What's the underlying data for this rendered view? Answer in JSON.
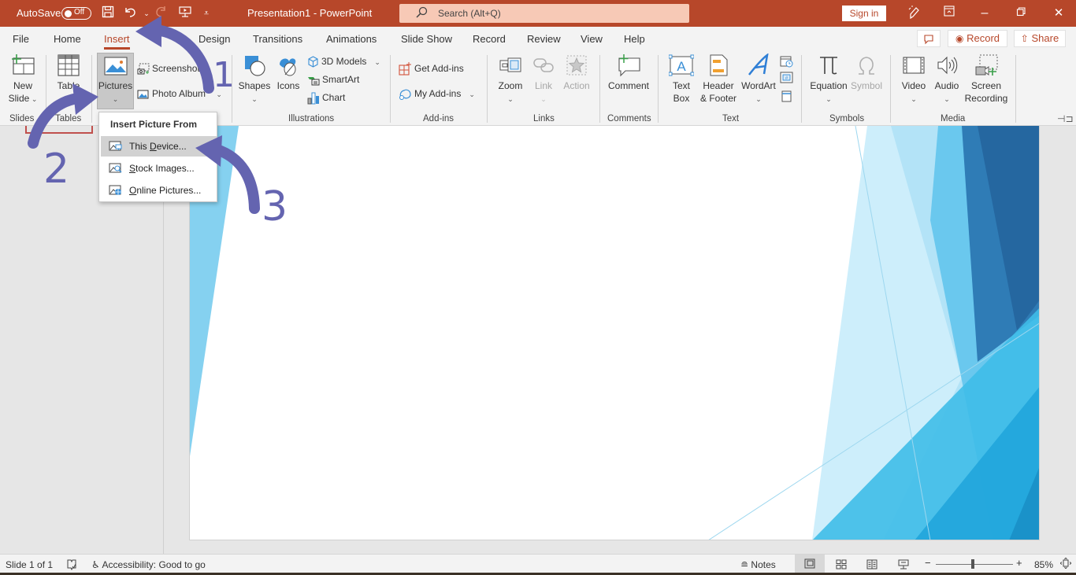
{
  "titlebar": {
    "autosave_label": "AutoSave",
    "autosave_state": "Off",
    "document_title": "Presentation1  -  PowerPoint",
    "search_placeholder": "Search (Alt+Q)",
    "sign_in": "Sign in"
  },
  "tabs": [
    {
      "label": "File"
    },
    {
      "label": "Home"
    },
    {
      "label": "Insert",
      "active": true
    },
    {
      "label": "Design"
    },
    {
      "label": "Transitions"
    },
    {
      "label": "Animations"
    },
    {
      "label": "Slide Show"
    },
    {
      "label": "Record"
    },
    {
      "label": "Review"
    },
    {
      "label": "View"
    },
    {
      "label": "Help"
    }
  ],
  "tab_right": {
    "record": "Record",
    "share": "Share"
  },
  "ribbon": {
    "slides": {
      "group": "Slides",
      "new_slide_1": "New",
      "new_slide_2": "Slide"
    },
    "tables": {
      "group": "Tables",
      "table": "Table"
    },
    "images": {
      "pictures": "Pictures",
      "screenshot": "Screenshot",
      "photo_album": "Photo Album"
    },
    "illustrations": {
      "group": "Illustrations",
      "shapes": "Shapes",
      "icons": "Icons",
      "models": "3D Models",
      "smartart": "SmartArt",
      "chart": "Chart"
    },
    "addins": {
      "group": "Add-ins",
      "get": "Get Add-ins",
      "my": "My Add-ins"
    },
    "links": {
      "group": "Links",
      "zoom": "Zoom",
      "link": "Link",
      "action": "Action"
    },
    "comments": {
      "group": "Comments",
      "comment": "Comment"
    },
    "text": {
      "group": "Text",
      "textbox_1": "Text",
      "textbox_2": "Box",
      "hf_1": "Header",
      "hf_2": "& Footer",
      "wordart": "WordArt"
    },
    "symbols": {
      "group": "Symbols",
      "equation": "Equation",
      "symbol": "Symbol"
    },
    "media": {
      "group": "Media",
      "video": "Video",
      "audio": "Audio",
      "screen_1": "Screen",
      "screen_2": "Recording"
    }
  },
  "picture_menu": {
    "header": "Insert Picture From",
    "items": [
      {
        "pre": "This ",
        "key": "D",
        "post": "evice...",
        "hover": true
      },
      {
        "pre": "",
        "key": "S",
        "post": "tock Images..."
      },
      {
        "pre": "",
        "key": "O",
        "post": "nline Pictures..."
      }
    ]
  },
  "annotations": {
    "step1": "1",
    "step2": "2",
    "step3": "3",
    "arrow_color": "#6464b0"
  },
  "statusbar": {
    "slide_info": "Slide 1 of 1",
    "accessibility": "Accessibility: Good to go",
    "notes": "Notes",
    "zoom_level": "85%",
    "zoom_fraction": 0.48
  },
  "colors": {
    "accent": "#b7472a",
    "slide_blue_light": "#7fd0f0",
    "slide_blue_dark": "#1f6aa5"
  }
}
